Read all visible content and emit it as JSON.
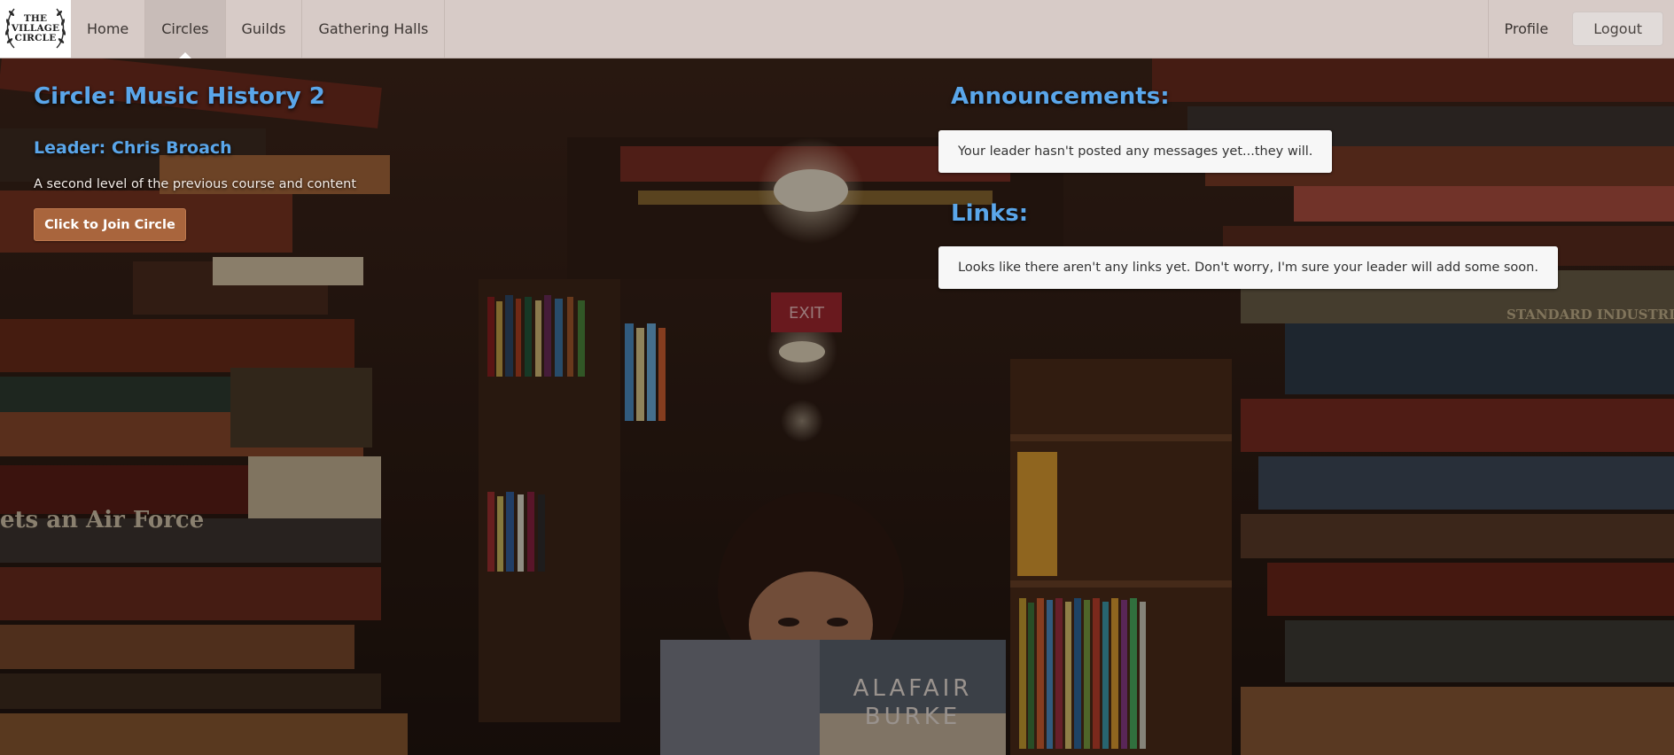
{
  "logo": {
    "line1": "THE",
    "line2": "VILLAGE",
    "line3": "CIRCLE"
  },
  "nav": {
    "items": [
      {
        "label": "Home"
      },
      {
        "label": "Circles",
        "active": true
      },
      {
        "label": "Guilds"
      },
      {
        "label": "Gathering Halls"
      }
    ],
    "profile_label": "Profile",
    "logout_label": "Logout"
  },
  "circle": {
    "title": "Circle: Music History 2",
    "leader": "Leader: Chris Broach",
    "description": "A second level of the previous course and content",
    "join_label": "Click to Join Circle"
  },
  "announcements": {
    "heading": "Announcements:",
    "message": "Your leader hasn't posted any messages yet...they will."
  },
  "links": {
    "heading": "Links:",
    "message": "Looks like there aren't any links yet. Don't worry, I'm sure your leader will add some soon."
  },
  "background": {
    "book_cover_title_1": "ALAFAIR",
    "book_cover_title_2": "BURKE",
    "spine_text_left": "ets an Air Force",
    "spine_text_right": "STANDARD INDUSTRIAL CLAS",
    "exit_sign": "EXIT"
  },
  "colors": {
    "nav_bg": "#d7cbc7",
    "heading_blue": "#5aa6ea",
    "join_button": "#a9653d"
  }
}
